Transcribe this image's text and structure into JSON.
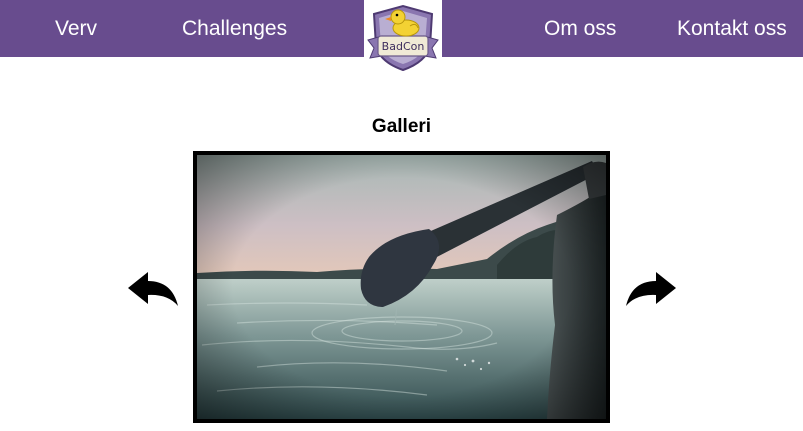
{
  "nav": {
    "left_items": [
      {
        "label": "Verv"
      },
      {
        "label": "Challenges"
      }
    ],
    "right_items": [
      {
        "label": "Om oss"
      },
      {
        "label": "Kontakt oss"
      }
    ]
  },
  "logo": {
    "text": "BadCon",
    "icon": "duck-shield-icon"
  },
  "gallery": {
    "title": "Galleri",
    "image_icon": "paddle-lake-photo",
    "prev_icon": "curved-arrow-left-icon",
    "next_icon": "curved-arrow-right-icon"
  },
  "colors": {
    "nav_background": "#684c8e",
    "nav_text": "#ffffff",
    "page_background": "#ffffff",
    "frame_border": "#000000"
  }
}
